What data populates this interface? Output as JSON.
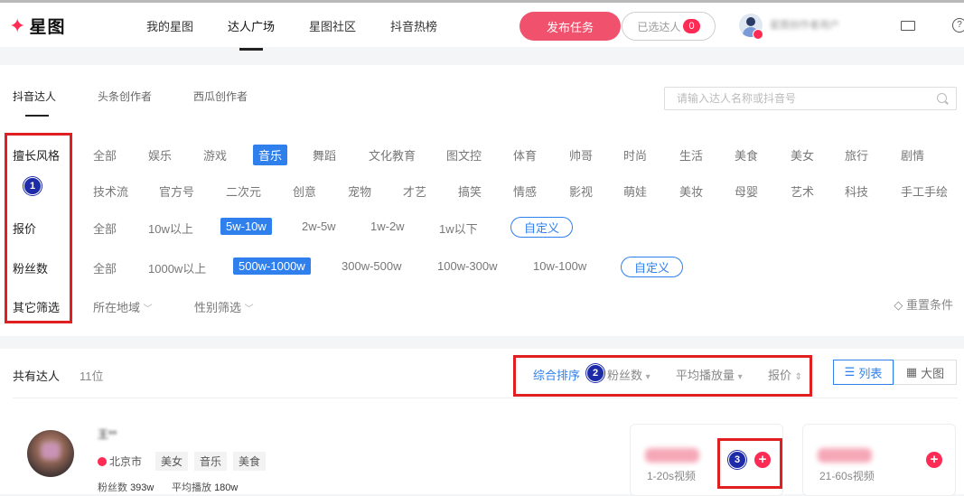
{
  "header": {
    "logo_text": "星图",
    "nav": [
      "我的星图",
      "达人广场",
      "星图社区",
      "抖音热榜"
    ],
    "publish_label": "发布任务",
    "selected_label": "已选达人",
    "selected_count": "0",
    "user_name": "星图创作者用户"
  },
  "tabs": [
    "抖音达人",
    "头条创作者",
    "西瓜创作者"
  ],
  "search": {
    "placeholder": "请输入达人名称或抖音号"
  },
  "filters": {
    "style_label": "擅长风格",
    "style_row1": [
      "全部",
      "娱乐",
      "游戏",
      "音乐",
      "舞蹈",
      "文化教育",
      "图文控",
      "体育",
      "帅哥",
      "时尚",
      "生活",
      "美食",
      "美女",
      "旅行",
      "剧情"
    ],
    "style_row2": [
      "技术流",
      "官方号",
      "二次元",
      "创意",
      "宠物",
      "才艺",
      "搞笑",
      "情感",
      "影视",
      "萌娃",
      "美妆",
      "母婴",
      "艺术",
      "科技",
      "手工手绘"
    ],
    "price_label": "报价",
    "price_options": [
      "全部",
      "10w以上",
      "5w-10w",
      "2w-5w",
      "1w-2w",
      "1w以下",
      "自定义"
    ],
    "fans_label": "粉丝数",
    "fans_options": [
      "全部",
      "1000w以上",
      "500w-1000w",
      "300w-500w",
      "100w-300w",
      "10w-100w",
      "自定义"
    ],
    "other_label": "其它筛选",
    "other_options": [
      "所在地域",
      "性别筛选"
    ],
    "reset_label": "重置条件"
  },
  "annotations": [
    "1",
    "2",
    "3"
  ],
  "list": {
    "total_label": "共有达人",
    "total_count": "11位",
    "sort_options": [
      "综合排序",
      "粉丝数",
      "平均播放量",
      "报价"
    ],
    "view_list": "列表",
    "view_grid": "大图"
  },
  "kol": {
    "name": "王**",
    "city": "北京市",
    "tags": [
      "美女",
      "音乐",
      "美食"
    ],
    "fans_label": "粉丝数",
    "fans_value": "393w",
    "play_label": "平均播放",
    "play_value": "180w",
    "price_card_1_label": "1-20s视频",
    "price_card_2_label": "21-60s视频"
  },
  "colors": {
    "brand": "#fe2c55",
    "primary": "#2f80ed",
    "annotation": "#e02020"
  }
}
